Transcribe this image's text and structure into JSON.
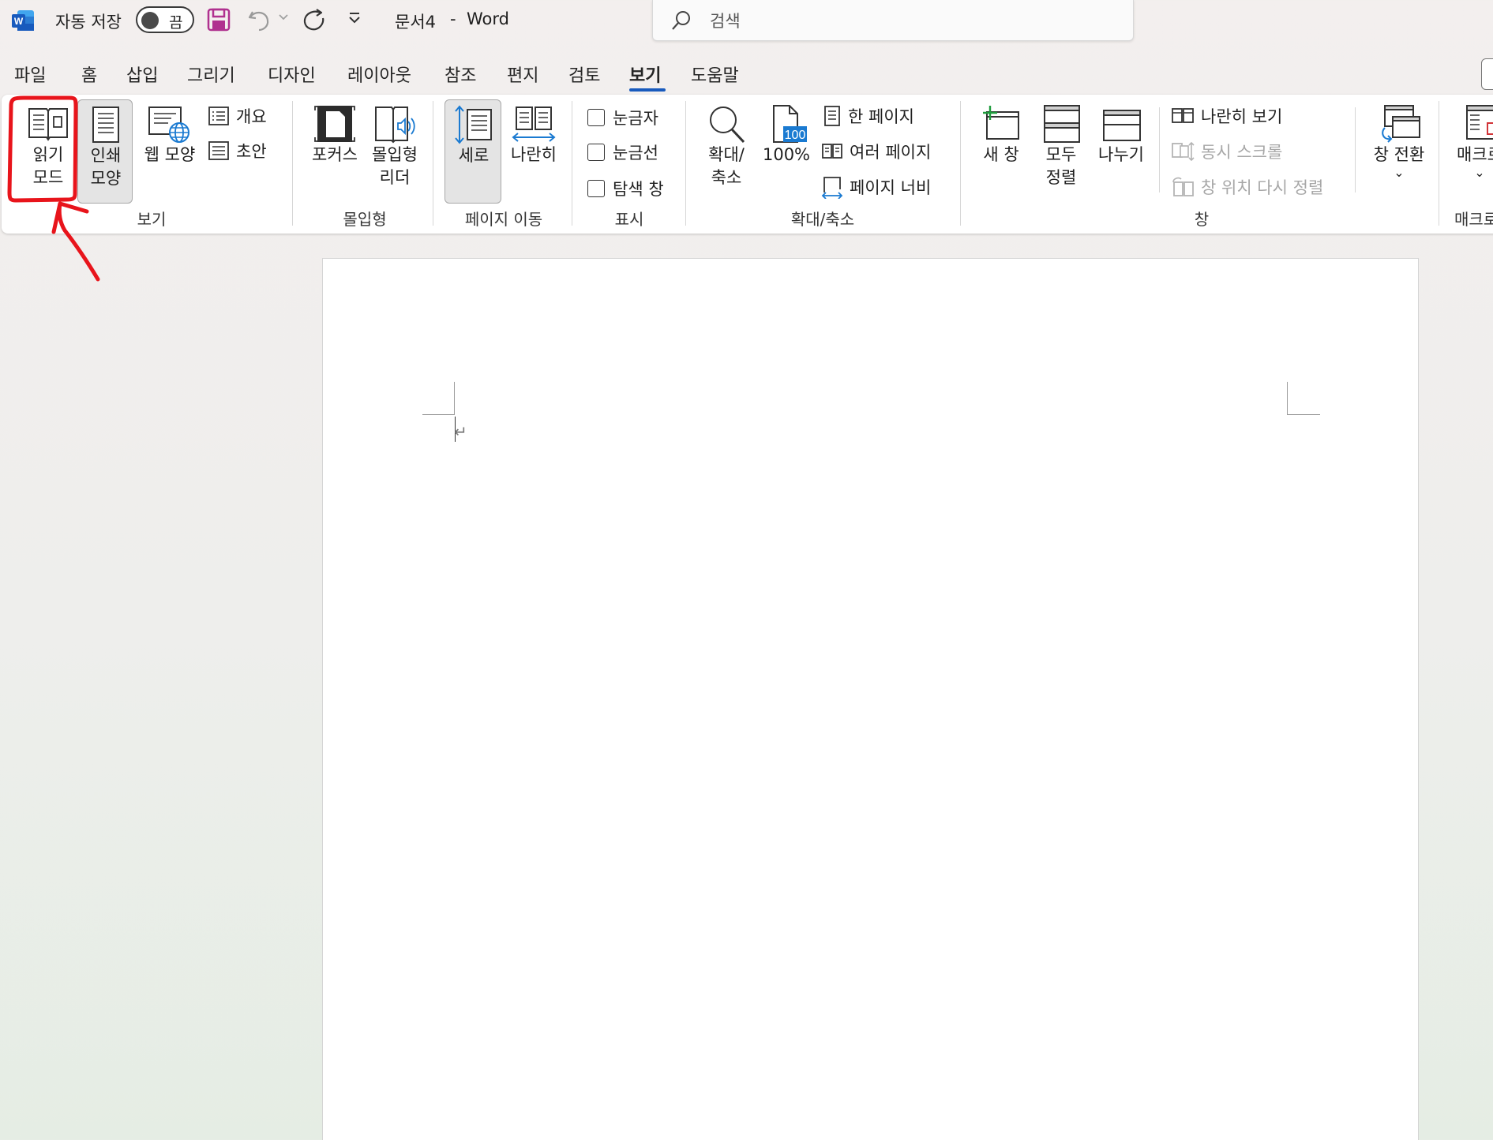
{
  "titlebar": {
    "app_icon": "word-icon",
    "autosave_label": "자동 저장",
    "autosave_state": "끔",
    "doc_title": "문서4",
    "title_separator": "-",
    "app_name": "Word"
  },
  "search": {
    "placeholder": "검색"
  },
  "tabs": [
    "파일",
    "홈",
    "삽입",
    "그리기",
    "디자인",
    "레이아웃",
    "참조",
    "편지",
    "검토",
    "보기",
    "도움말"
  ],
  "active_tab": "보기",
  "ribbon": {
    "groups": {
      "views": {
        "label": "보기",
        "read_mode": [
          "읽기",
          "모드"
        ],
        "print_layout": [
          "인쇄",
          "모양"
        ],
        "web_layout": "웹 모양",
        "outline": "개요",
        "draft": "초안"
      },
      "immersive": {
        "label": "몰입형",
        "focus": "포커스",
        "reader": [
          "몰입형",
          "리더"
        ]
      },
      "page_movement": {
        "label": "페이지 이동",
        "vertical": "세로",
        "side_to_side": "나란히"
      },
      "show": {
        "label": "표시",
        "ruler": "눈금자",
        "gridlines": "눈금선",
        "nav_pane": "탐색 창"
      },
      "zoom": {
        "label": "확대/축소",
        "zoom": [
          "확대/",
          "축소"
        ],
        "hundred_icon_text": "100",
        "hundred": "100%",
        "one_page": "한 페이지",
        "multiple_pages": "여러 페이지",
        "page_width": "페이지 너비"
      },
      "window": {
        "label": "창",
        "new_window": "새 창",
        "arrange_all": [
          "모두",
          "정렬"
        ],
        "split": "나누기",
        "side_by_side": "나란히 보기",
        "sync_scroll": "동시 스크롤",
        "reset_position": "창 위치 다시 정렬",
        "switch_windows": "창 전환",
        "switch_chevron": "⌄"
      },
      "macros": {
        "label": "매크로",
        "macros": "매크로",
        "chevron": "⌄"
      }
    }
  },
  "document": {
    "paragraph_mark": "↵"
  },
  "annotation": {
    "color": "#e8141b"
  },
  "colors": {
    "accent": "#185abd",
    "save_icon": "#b0318f",
    "word_blue": "#185abd"
  }
}
